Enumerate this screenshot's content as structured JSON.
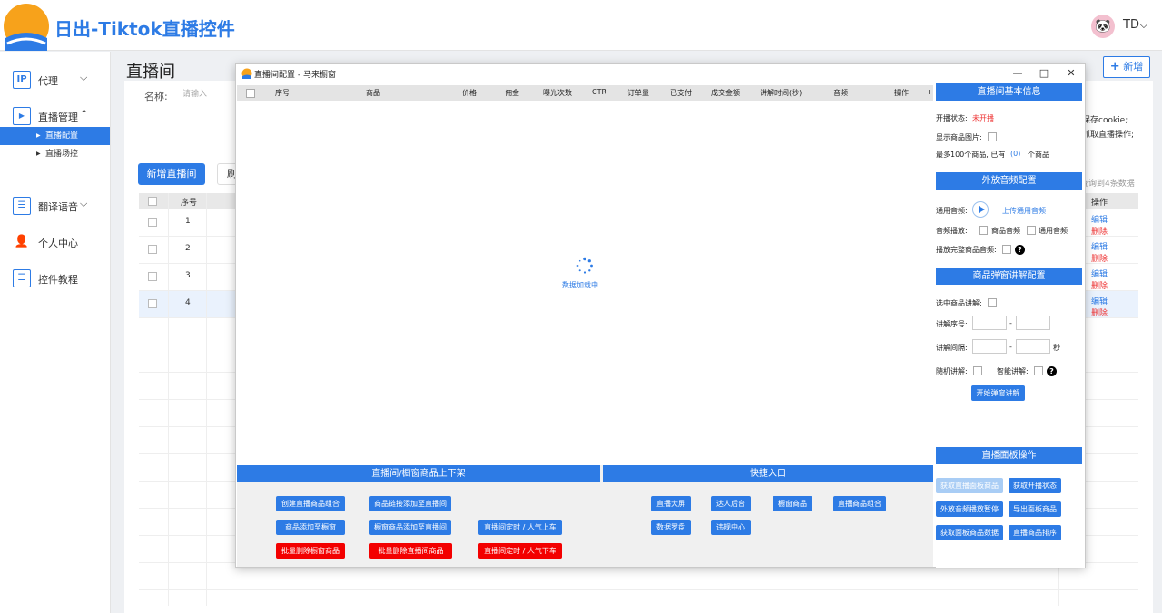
{
  "app": {
    "brand": "日出-Tiktok直播控件",
    "user": "TD",
    "user_chevron": "⌵"
  },
  "sidebar": {
    "items": [
      {
        "icon": "IP",
        "label": "代理",
        "arrow": "⌵"
      },
      {
        "icon": "▶",
        "label": "直播管理",
        "arrow": "⌃"
      },
      {
        "icon": "☰",
        "label": "翻译语音",
        "arrow": "⌵"
      },
      {
        "icon": "👤",
        "label": "个人中心"
      },
      {
        "icon": "☰",
        "label": "控件教程"
      }
    ],
    "subitems": [
      {
        "label": "直播配置",
        "active": true
      },
      {
        "label": "直播场控",
        "active": false
      }
    ]
  },
  "main": {
    "page_title": "直播间",
    "add_button": "新增",
    "filter": {
      "label": "名称:",
      "placeholder": "请输入"
    },
    "hints": [
      "保存cookie;",
      "抓取直播操作;"
    ],
    "new_room_button": "新增直播间",
    "refresh_button": "刷",
    "count_text": "查询到4条数据",
    "table": {
      "headers": {
        "seq": "序号",
        "op": "操作"
      },
      "rows": [
        {
          "num": "1",
          "edit": "编辑",
          "del": "删除"
        },
        {
          "num": "2",
          "edit": "编辑",
          "del": "删除"
        },
        {
          "num": "3",
          "edit": "编辑",
          "del": "删除"
        },
        {
          "num": "4",
          "edit": "编辑",
          "del": "删除"
        }
      ]
    }
  },
  "dialog": {
    "title": "直播间配置 - 马来橱窗",
    "window_buttons": {
      "minimize": "—",
      "maximize": "□",
      "close": "✕"
    },
    "columns": [
      "序号",
      "商品",
      "价格",
      "佣金",
      "曝光次数",
      "CTR",
      "订单量",
      "已支付",
      "成交金额",
      "讲解时间(秒)",
      "音频",
      "操作",
      "+"
    ],
    "loading_text": "数据加载中......",
    "basic_info": {
      "title": "直播间基本信息",
      "status_label": "开播状态:",
      "status_value": "未开播",
      "show_image_label": "显示商品图片:",
      "max_prefix": "最多100个商品, 已有",
      "max_count": "(0)",
      "max_suffix": "个商品"
    },
    "audio": {
      "title": "外放音频配置",
      "general_label": "通用音频:",
      "upload_link": "上传通用音频",
      "play_label": "音频播放:",
      "opt_product": "商品音频",
      "opt_general": "通用音频",
      "full_play_label": "播放完整商品音频:"
    },
    "popup": {
      "title": "商品弹窗讲解配置",
      "selected_label": "选中商品讲解:",
      "seq_label": "讲解序号:",
      "interval_label": "讲解间隔:",
      "dash": "-",
      "unit_sec": "秒",
      "random_label": "随机讲解:",
      "smart_label": "智能讲解:",
      "start_button": "开始弹窗讲解"
    },
    "bottom": {
      "shelf_title": "直播间/橱窗商品上下架",
      "shortcut_title": "快捷入口",
      "panel_title": "直播面板操作",
      "shelf_buttons": {
        "create_combo": "创建直播商品组合",
        "link_add": "商品链接添加至直播间",
        "add_window": "商品添加至橱窗",
        "window_add": "橱窗商品添加至直播间",
        "timer_up": "直播间定时 / 人气上车",
        "batch_del_window": "批量删除橱窗商品",
        "batch_del_room": "批量删除直播间商品",
        "timer_down": "直播间定时 / 人气下车"
      },
      "shortcut_buttons": {
        "big_screen": "直播大屏",
        "creator": "达人后台",
        "window_goods": "橱窗商品",
        "room_combo": "直播商品组合",
        "compass": "数据罗盘",
        "violation": "违规中心"
      },
      "panel_buttons": {
        "get_panel_goods": "获取直播面板商品",
        "get_status": "获取开播状态",
        "pause_audio": "外放音频播放暂停",
        "export_panel": "导出面板商品",
        "get_panel_data": "获取面板商品数据",
        "sort_goods": "直播商品排序"
      }
    }
  }
}
